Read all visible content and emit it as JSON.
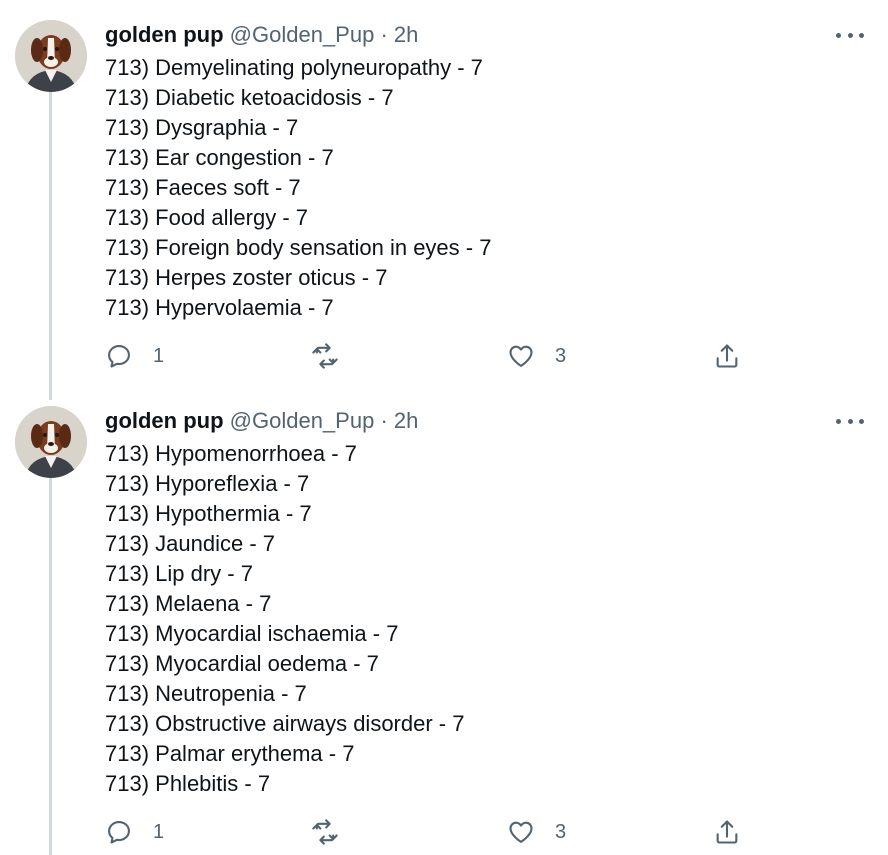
{
  "tweets": [
    {
      "author": {
        "name": "golden pup",
        "handle": "@Golden_Pup"
      },
      "separator": "·",
      "time": "2h",
      "lines": [
        "713) Demyelinating polyneuropathy - 7",
        "713) Diabetic ketoacidosis - 7",
        "713) Dysgraphia - 7",
        "713) Ear congestion - 7",
        "713) Faeces soft - 7",
        "713) Food allergy - 7",
        "713) Foreign body sensation in eyes - 7",
        "713) Herpes zoster oticus - 7",
        "713) Hypervolaemia - 7"
      ],
      "actions": {
        "reply_count": "1",
        "retweet_count": "",
        "like_count": "3"
      }
    },
    {
      "author": {
        "name": "golden pup",
        "handle": "@Golden_Pup"
      },
      "separator": "·",
      "time": "2h",
      "lines": [
        "713) Hypomenorrhoea - 7",
        "713) Hyporeflexia - 7",
        "713) Hypothermia - 7",
        "713) Jaundice - 7",
        "713) Lip dry - 7",
        "713) Melaena - 7",
        "713) Myocardial ischaemia - 7",
        "713) Myocardial oedema - 7",
        "713) Neutropenia - 7",
        "713) Obstructive airways disorder - 7",
        "713) Palmar erythema - 7",
        "713) Phlebitis - 7"
      ],
      "actions": {
        "reply_count": "1",
        "retweet_count": "",
        "like_count": "3"
      }
    }
  ],
  "icons": {
    "avatar": "dog-portrait-avatar",
    "more": "more-options-icon",
    "reply": "reply-icon",
    "retweet": "retweet-icon",
    "like": "like-icon",
    "share": "share-icon"
  },
  "colors": {
    "text": "#0f1419",
    "muted": "#536471",
    "thread_line": "#cfd9de"
  }
}
